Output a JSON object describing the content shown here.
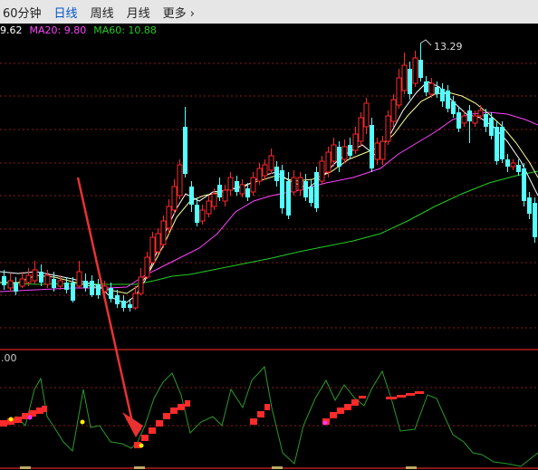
{
  "toolbar": {
    "tabs": [
      {
        "label": "60分钟",
        "active": false
      },
      {
        "label": "日线",
        "active": true
      },
      {
        "label": "周线",
        "active": false
      },
      {
        "label": "月线",
        "active": false
      },
      {
        "label": "更多 ›",
        "active": false
      }
    ]
  },
  "ma_legend": {
    "ma5": "9.62",
    "ma20": "MA20: 9.80",
    "ma60": "MA60: 10.88"
  },
  "price_chart": {
    "high_marker": "13.29"
  },
  "indicator_panel": {
    "label": ".00"
  },
  "colors": {
    "up": "#ff2a2a",
    "down": "#54ffff",
    "ma5": "#ffffff",
    "ma10": "#ffff99",
    "ma20": "#ff44ff",
    "ma60": "#22cc22",
    "grid": "#8a1a1a",
    "arrow": "#e83232"
  }
}
